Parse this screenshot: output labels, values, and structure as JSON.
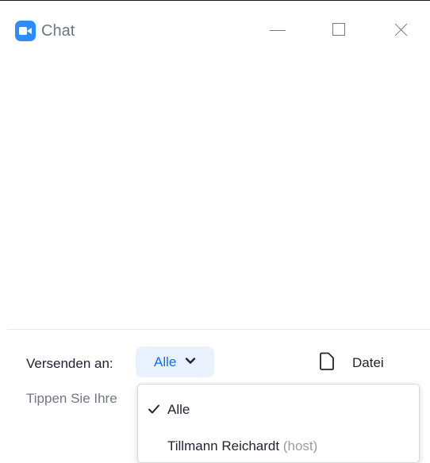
{
  "window": {
    "title": "Chat",
    "icon": "zoom-camera-icon",
    "accent_color": "#2d8cff"
  },
  "composer": {
    "send_to_label": "Versenden an:",
    "recipient_selected": "Alle",
    "file_label": "Datei",
    "message_placeholder": "Tippen Sie Ihre"
  },
  "recipient_dropdown": {
    "options": [
      {
        "label": "Alle",
        "selected": true
      },
      {
        "label": "Tillmann Reichardt",
        "tag": "(host)",
        "selected": false
      }
    ]
  }
}
